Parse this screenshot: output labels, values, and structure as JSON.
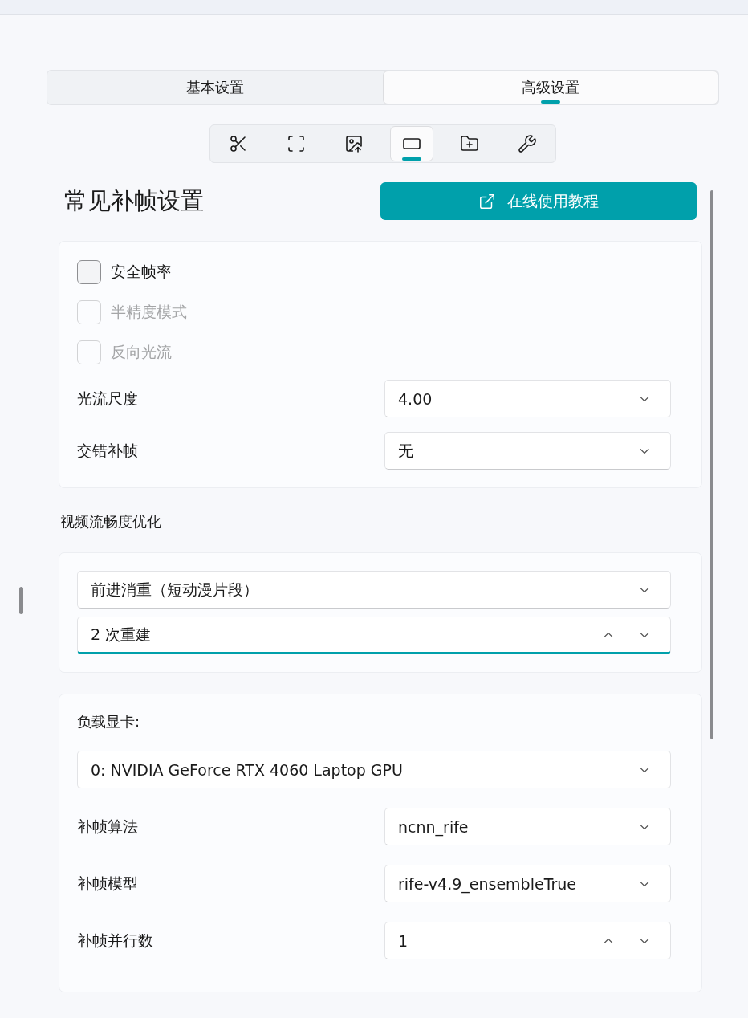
{
  "tabs": [
    {
      "label": "基本设置",
      "selected": false
    },
    {
      "label": "高级设置",
      "selected": true
    }
  ],
  "toolbar": [
    {
      "kind": "scissors",
      "selected": false
    },
    {
      "kind": "scan",
      "selected": false
    },
    {
      "kind": "image",
      "selected": false
    },
    {
      "kind": "frame",
      "selected": true
    },
    {
      "kind": "folder",
      "selected": false
    },
    {
      "kind": "tools",
      "selected": false
    }
  ],
  "title": "常见补帧设置",
  "tutorial_button": "在线使用教程",
  "card1": {
    "checkboxes": [
      {
        "label": "安全帧率",
        "checked": false,
        "disabled": false
      },
      {
        "label": "半精度模式",
        "checked": false,
        "disabled": true
      },
      {
        "label": "反向光流",
        "checked": false,
        "disabled": true
      }
    ],
    "rows": [
      {
        "label": "光流尺度",
        "value": "4.00",
        "kind": "select"
      },
      {
        "label": "交错补帧",
        "value": "无",
        "kind": "select"
      }
    ]
  },
  "section_label": "视频流畅度优化",
  "card2": [
    {
      "kind": "select",
      "value": "前进消重（短动漫片段）"
    },
    {
      "kind": "spin",
      "value": "2 次重建",
      "focused": true
    }
  ],
  "card3": {
    "gpu_label": "负载显卡:",
    "gpu_value": "0: NVIDIA GeForce RTX 4060 Laptop GPU",
    "rows": [
      {
        "label": "补帧算法",
        "value": "ncnn_rife",
        "kind": "select"
      },
      {
        "label": "补帧模型",
        "value": "rife-v4.9_ensembleTrue",
        "kind": "select"
      },
      {
        "label": "补帧并行数",
        "value": "1",
        "kind": "spin"
      }
    ]
  }
}
